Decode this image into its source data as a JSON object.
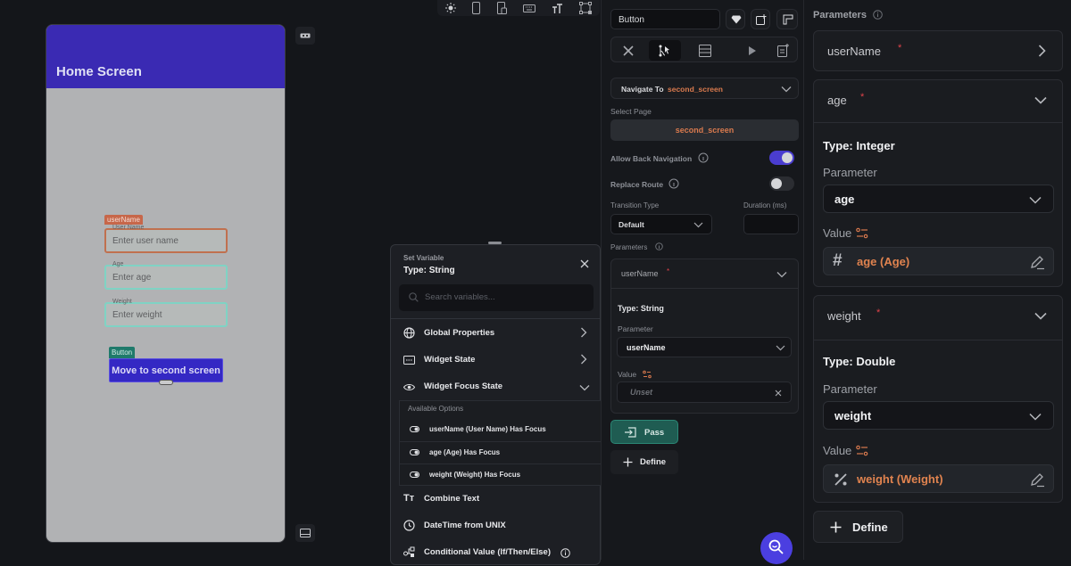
{
  "canvas": {
    "app_bar_title": "Home Screen",
    "fields": [
      {
        "tag": "userName",
        "label": "User Name",
        "placeholder": "Enter user name"
      },
      {
        "label": "Age",
        "placeholder": "Enter age"
      },
      {
        "label": "Weight",
        "placeholder": "Enter weight"
      }
    ],
    "button_tag": "Button",
    "button_label": "Move to second screen"
  },
  "top_toolbar": {
    "icons": [
      "sun-icon",
      "phone-icon",
      "tablet-icon",
      "keyboard-icon",
      "text-size-icon",
      "graph-icon"
    ]
  },
  "set_variable": {
    "subtitle": "Set Variable",
    "title": "Type: String",
    "search_placeholder": "Search variables...",
    "items": [
      {
        "label": "Global Properties",
        "icon": "globe-icon",
        "expanded": false
      },
      {
        "label": "Widget State",
        "icon": "widget-state-icon",
        "expanded": false
      },
      {
        "label": "Widget Focus State",
        "icon": "eye-icon",
        "expanded": true
      }
    ],
    "available_options_label": "Available Options",
    "options": [
      "userName (User Name) Has Focus",
      "age (Age) Has Focus",
      "weight (Weight) Has Focus"
    ],
    "more_items": [
      {
        "label": "Combine Text",
        "icon": "text-icon"
      },
      {
        "label": "DateTime from UNIX",
        "icon": "clock-icon"
      },
      {
        "label": "Conditional Value (If/Then/Else)",
        "icon": "conditional-icon"
      }
    ]
  },
  "properties": {
    "widget_name": "Button",
    "action_label": "Navigate To",
    "action_target": "second_screen",
    "select_page_label": "Select Page",
    "select_page_value": "second_screen",
    "allow_back_label": "Allow Back Navigation",
    "allow_back_on": true,
    "replace_route_label": "Replace Route",
    "replace_route_on": false,
    "transition_label": "Transition Type",
    "transition_value": "Default",
    "duration_label": "Duration (ms)",
    "duration_value": "",
    "parameters_label": "Parameters",
    "param": {
      "name": "userName",
      "type": "Type: String",
      "parameter_label": "Parameter",
      "parameter_value": "userName",
      "value_label": "Value",
      "value": "Unset"
    },
    "pass_label": "Pass",
    "define_label": "Define"
  },
  "right_panel": {
    "parameters_label": "Parameters",
    "params": [
      {
        "name": "userName",
        "expanded": false
      },
      {
        "name": "age",
        "expanded": true,
        "type": "Type: Integer",
        "parameter_label": "Parameter",
        "parameter_value": "age",
        "value_label": "Value",
        "value": "age (Age)"
      },
      {
        "name": "weight",
        "expanded": true,
        "type": "Type: Double",
        "parameter_label": "Parameter",
        "parameter_value": "weight",
        "value_label": "Value",
        "value": "weight (Weight)"
      }
    ],
    "define_label": "Define"
  },
  "colors": {
    "accent": "#3a2ab3",
    "orange": "#d97a4e",
    "teal": "#1f7a6b",
    "required": "#e0434a"
  }
}
